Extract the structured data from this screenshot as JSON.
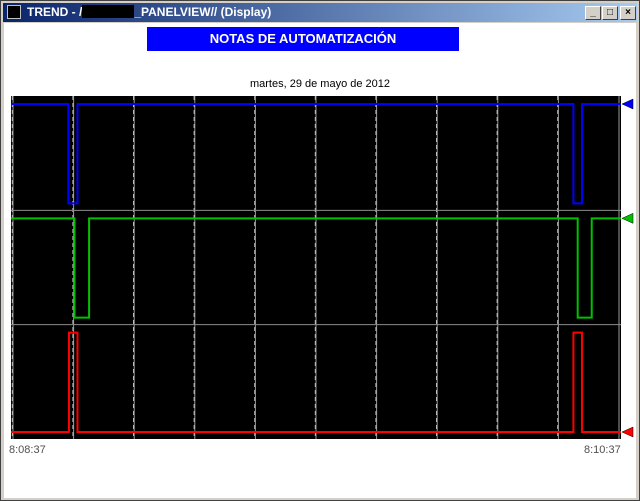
{
  "window": {
    "title_prefix": "TREND - /",
    "title_suffix": "_PANELVIEW// (Display)",
    "minimize_glyph": "_",
    "maximize_glyph": "□",
    "close_glyph": "×"
  },
  "banner": {
    "text": "NOTAS DE AUTOMATIZACIÓN",
    "color": "#0000ff"
  },
  "date_label": "martes, 29 de mayo de 2012",
  "time_axis": {
    "start": "8:08:37",
    "end": "8:10:37"
  },
  "chart_data": {
    "type": "line",
    "title": "martes, 29 de mayo de 2012",
    "x_range": [
      "8:08:37",
      "8:10:37"
    ],
    "grid": true,
    "series": [
      {
        "color": "#0000ff",
        "band": "top",
        "pulse": "low",
        "pulses_at_fraction": [
          [
            0.094,
            0.109
          ],
          [
            0.922,
            0.936
          ]
        ]
      },
      {
        "color": "#00c000",
        "band": "middle",
        "pulse": "low",
        "pulses_at_fraction": [
          [
            0.104,
            0.128
          ],
          [
            0.929,
            0.952
          ]
        ]
      },
      {
        "color": "#ff0000",
        "band": "bottom",
        "pulse": "high",
        "pulses_at_fraction": [
          [
            0.095,
            0.109
          ],
          [
            0.922,
            0.936
          ]
        ]
      }
    ]
  }
}
